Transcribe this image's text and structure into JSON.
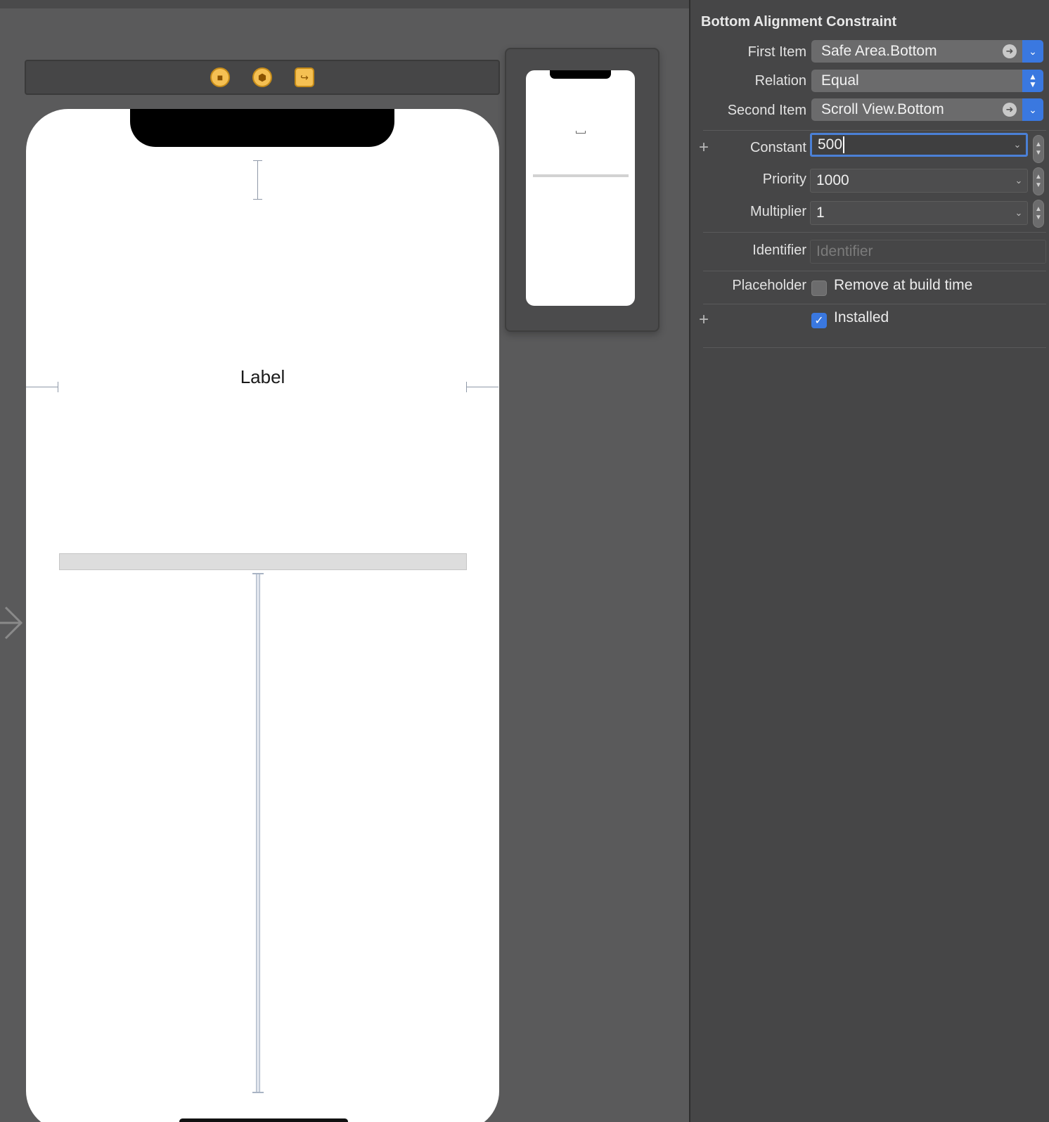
{
  "canvas": {
    "label_text": "Label",
    "scene_icons": [
      "view-controller-icon",
      "first-responder-icon",
      "exit-icon"
    ]
  },
  "inspector": {
    "title": "Bottom Alignment Constraint",
    "first_item": {
      "label": "First Item",
      "value": "Safe Area.Bottom"
    },
    "relation": {
      "label": "Relation",
      "value": "Equal"
    },
    "second_item": {
      "label": "Second Item",
      "value": "Scroll View.Bottom"
    },
    "constant": {
      "label": "Constant",
      "value": "500"
    },
    "priority": {
      "label": "Priority",
      "value": "1000"
    },
    "multiplier": {
      "label": "Multiplier",
      "value": "1"
    },
    "identifier": {
      "label": "Identifier",
      "placeholder": "Identifier",
      "value": ""
    },
    "placeholder": {
      "label": "Placeholder",
      "option": "Remove at build time",
      "checked": false
    },
    "installed": {
      "option": "Installed",
      "checked": true
    },
    "colors": {
      "accent": "#3a78e0",
      "panel": "#464647",
      "canvas": "#5a5a5b"
    }
  }
}
